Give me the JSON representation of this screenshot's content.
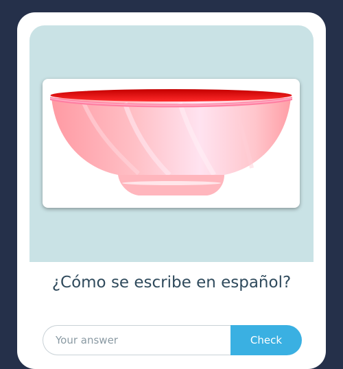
{
  "question": {
    "text": "¿Cómo se escribe en español?"
  },
  "image": {
    "subject": "bowl-illustration"
  },
  "answer": {
    "value": "",
    "placeholder": "Your answer"
  },
  "buttons": {
    "check_label": "Check"
  },
  "colors": {
    "background": "#25304a",
    "card": "#ffffff",
    "image_panel": "#c9e2e5",
    "accent": "#3ab0e2",
    "bowl_rim": "#e01414",
    "bowl_body": "#ffb3b8",
    "question_text": "#2f4a5c"
  }
}
